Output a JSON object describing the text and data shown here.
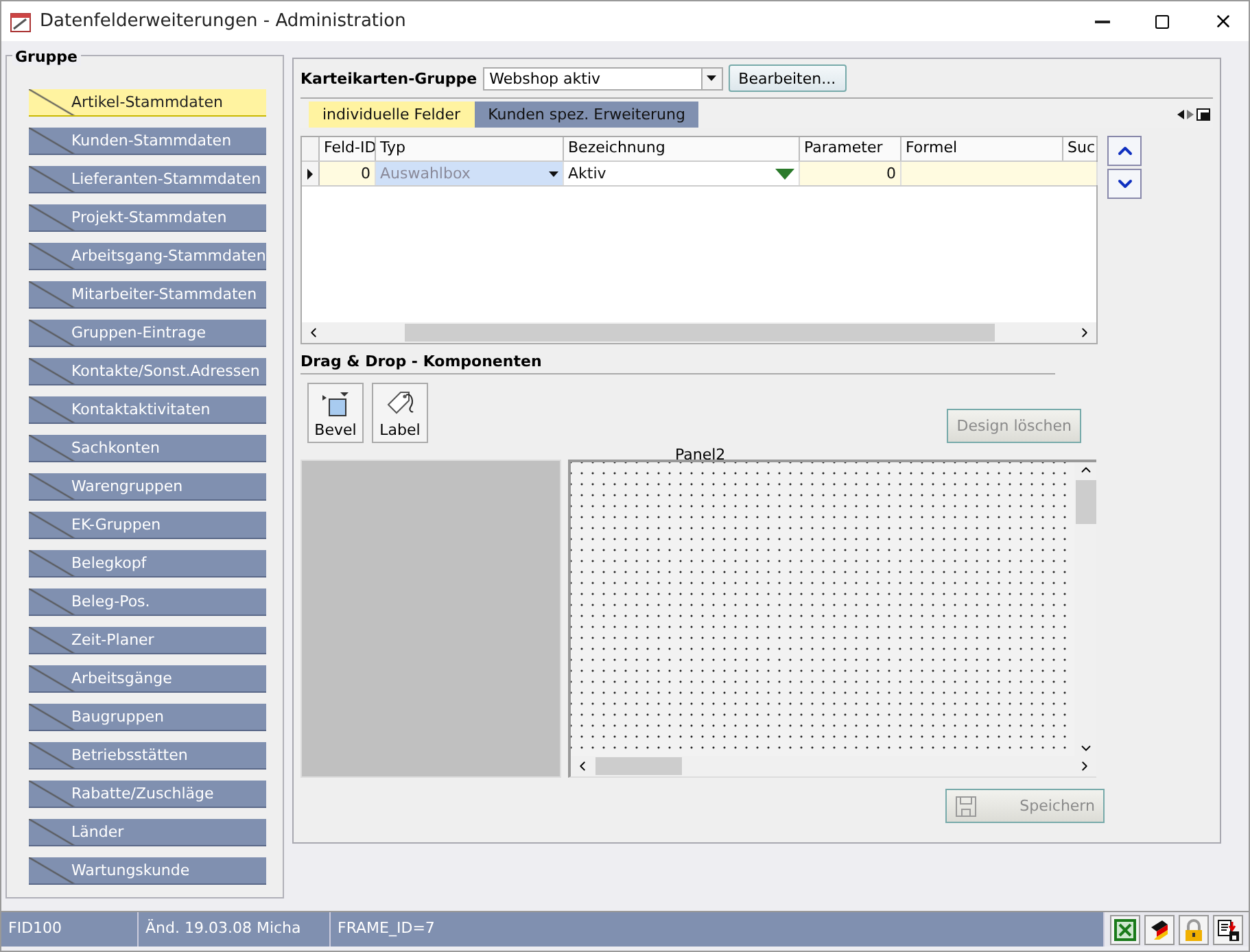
{
  "window": {
    "title": "Datenfelderweiterungen - Administration"
  },
  "sidebar": {
    "title": "Gruppe",
    "items": [
      {
        "label": "Artikel-Stammdaten",
        "selected": true
      },
      {
        "label": "Kunden-Stammdaten",
        "selected": false
      },
      {
        "label": "Lieferanten-Stammdaten",
        "selected": false
      },
      {
        "label": "Projekt-Stammdaten",
        "selected": false
      },
      {
        "label": "Arbeitsgang-Stammdaten",
        "selected": false
      },
      {
        "label": "Mitarbeiter-Stammdaten",
        "selected": false
      },
      {
        "label": "Gruppen-Eintrage",
        "selected": false
      },
      {
        "label": "Kontakte/Sonst.Adressen",
        "selected": false
      },
      {
        "label": "Kontaktaktivitaten",
        "selected": false
      },
      {
        "label": "Sachkonten",
        "selected": false
      },
      {
        "label": "Warengruppen",
        "selected": false
      },
      {
        "label": "EK-Gruppen",
        "selected": false
      },
      {
        "label": "Belegkopf",
        "selected": false
      },
      {
        "label": "Beleg-Pos.",
        "selected": false
      },
      {
        "label": "Zeit-Planer",
        "selected": false
      },
      {
        "label": "Arbeitsgänge",
        "selected": false
      },
      {
        "label": "Baugruppen",
        "selected": false
      },
      {
        "label": "Betriebsstätten",
        "selected": false
      },
      {
        "label": "Rabatte/Zuschläge",
        "selected": false
      },
      {
        "label": "Länder",
        "selected": false
      },
      {
        "label": "Wartungskunde",
        "selected": false
      }
    ]
  },
  "group_bar": {
    "label": "Karteikarten-Gruppe",
    "value": "Webshop aktiv",
    "button": "Bearbeiten..."
  },
  "tabs": [
    {
      "label": "individuelle Felder",
      "selected": true
    },
    {
      "label": "Kunden spez. Erweiterung",
      "selected": false
    }
  ],
  "grid": {
    "columns": [
      "Feld-ID",
      "Typ",
      "Bezeichnung",
      "Parameter",
      "Formel",
      "Suc"
    ],
    "rows": [
      {
        "feld_id": "0",
        "typ": "Auswahlbox",
        "bezeichnung": "Aktiv",
        "parameter": "0"
      }
    ]
  },
  "components": {
    "title": "Drag & Drop - Komponenten",
    "items": [
      {
        "label": "Bevel",
        "kind": "bevel"
      },
      {
        "label": "Label",
        "kind": "label"
      }
    ],
    "design_button": {
      "label": "Design löschen",
      "disabled": true
    }
  },
  "canvas": {
    "label": "Panel2"
  },
  "save_button": {
    "label": "Speichern",
    "disabled": true
  },
  "status_bar": [
    "FID100",
    "Änd. 19.03.08 Micha",
    "FRAME_ID=7"
  ]
}
